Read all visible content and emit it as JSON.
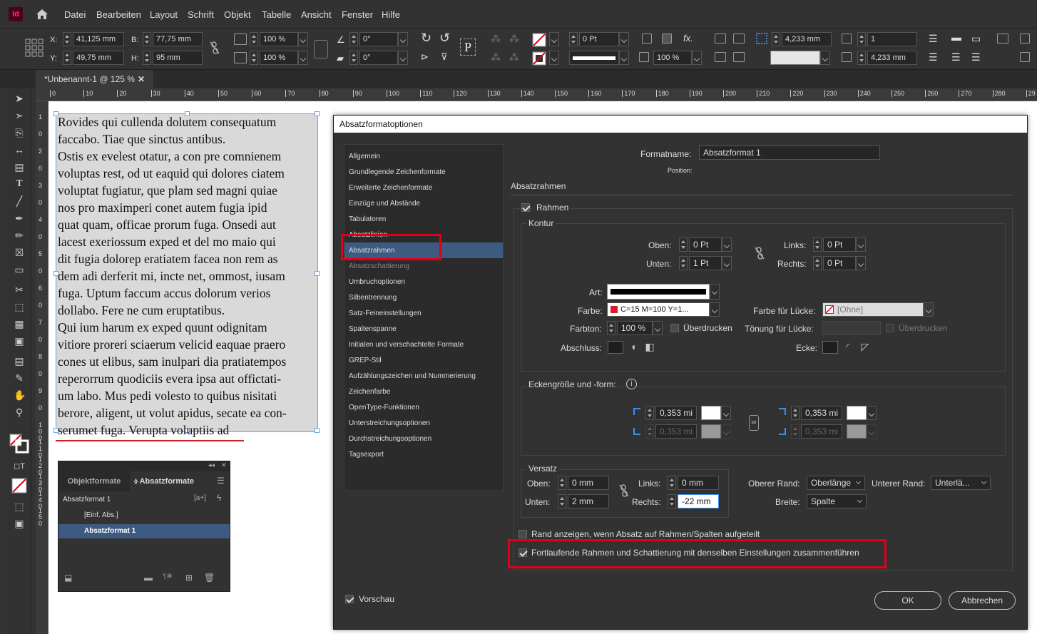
{
  "app": {
    "logo": "Id"
  },
  "menu": [
    "Datei",
    "Bearbeiten",
    "Layout",
    "Schrift",
    "Objekt",
    "Tabelle",
    "Ansicht",
    "Fenster",
    "Hilfe"
  ],
  "control": {
    "x_label": "X:",
    "x": "41,125 mm",
    "y_label": "Y:",
    "y": "49,75 mm",
    "b_label": "B:",
    "b": "77,75 mm",
    "h_label": "H:",
    "h": "95 mm",
    "scale_x": "100 %",
    "scale_y": "100 %",
    "angle": "0°",
    "shear": "0°",
    "stroke": "0 Pt",
    "opacity": "100 %",
    "gutter": "4,233 mm",
    "columns": "1",
    "col_gutter": "4,233 mm"
  },
  "document": {
    "tab": "*Unbenannt-1 @ 125 %"
  },
  "ruler": {
    "h": [
      "0",
      "10",
      "20",
      "30",
      "40",
      "50",
      "60",
      "70",
      "80",
      "90",
      "100",
      "110",
      "120",
      "130",
      "140",
      "150",
      "160",
      "170",
      "180",
      "190",
      "200",
      "210",
      "220",
      "230",
      "240",
      "250",
      "260",
      "270",
      "280",
      "29"
    ],
    "v": [
      "1",
      "0",
      "2",
      "0",
      "3",
      "0",
      "4",
      "0",
      "5",
      "0",
      "6",
      "0",
      "7",
      "0",
      "8",
      "0",
      "9",
      "0",
      "1\n0\n0",
      "1\n1\n0",
      "1\n2\n0",
      "1\n3\n0",
      "1\n4\n0",
      "1\n5\n0"
    ]
  },
  "text_lines": [
    "Rovides qui cullenda dolutem consequatum",
    "faccabo. Tiae que sinctus antibus.",
    "Ostis ex evelest otatur, a con pre comnienem",
    "voluptas rest, od ut eaquid qui dolores ciatem",
    "voluptat fugiatur, que plam sed magni quiae",
    "nos pro maximperi conet autem fugia ipid",
    "quat quam, officae prorum fuga. Onsedi aut",
    "lacest exeriossum exped et del mo maio qui",
    "dit fugia dolorep eratiatem facea non rem as",
    "dem adi derferit mi, incte net, ommost, iusam",
    "fuga. Uptum faccum accus dolorum verios",
    "dollabo. Fere ne cum eruptatibus.",
    "Qui ium harum ex exped quunt odignitam",
    "vitiore proreri sciaerum velicid eaquae praero",
    "cones ut elibus, sam inulpari dia pratiatempos",
    "reperorrum quodiciis evera ipsa aut offictati-",
    "um labo. Mus pedi volesto to quibus nisitati",
    "berore, aligent, ut volut apidus, secate ea con-",
    "serumet fuga. Verupta voluptiis ad"
  ],
  "styles_panel": {
    "tab1": "Objektformate",
    "tab2": "Absatzformate",
    "current": "Absatzformat 1",
    "items": [
      "[Einf. Abs.]",
      "Absatzformat 1"
    ]
  },
  "dialog": {
    "title": "Absatzformatoptionen",
    "categories": [
      "Allgemein",
      "Grundlegende Zeichenformate",
      "Erweiterte Zeichenformate",
      "Einzüge und Abstände",
      "Tabulatoren",
      "Absatzlinien",
      "Absatzrahmen",
      "Absatzschattierung",
      "Umbruchoptionen",
      "Silbentrennung",
      "Satz-Feineinstellungen",
      "Spaltenspanne",
      "Initialen und verschachtelte Formate",
      "GREP-Stil",
      "Aufzählungszeichen und Nummerierung",
      "Zeichenfarbe",
      "OpenType-Funktionen",
      "Unterstreichungsoptionen",
      "Durchstreichungsoptionen",
      "Tagsexport"
    ],
    "selected_category": "Absatzrahmen",
    "formatname_label": "Formatname:",
    "formatname": "Absatzformat 1",
    "position_label": "Position:",
    "section_title": "Absatzrahmen",
    "rahmen_label": "Rahmen",
    "kontur_label": "Kontur",
    "oben_label": "Oben:",
    "oben": "0 Pt",
    "unten_label": "Unten:",
    "unten": "1 Pt",
    "links_label": "Links:",
    "links": "0 Pt",
    "rechts_label": "Rechts:",
    "rechts": "0 Pt",
    "art_label": "Art:",
    "farbe_label": "Farbe:",
    "farbe": "C=15 M=100 Y=1...",
    "farbe_color": "#d0202a",
    "farbton_label": "Farbton:",
    "farbton": "100 %",
    "ueberdrucken": "Überdrucken",
    "abschluss_label": "Abschluss:",
    "farbe_luecke_label": "Farbe für Lücke:",
    "farbe_luecke": "[Ohne]",
    "toenung_luecke_label": "Tönung für Lücke:",
    "ueberdrucken2": "Überdrucken",
    "ecke_label": "Ecke:",
    "eckengroesse_label": "Eckengröße und -form:",
    "corner1": "0,353 mi",
    "corner2": "0,353 mi",
    "corner3": "0,353 mi",
    "corner4": "0,353 mi",
    "versatz_label": "Versatz",
    "v_oben_label": "Oben:",
    "v_oben": "0 mm",
    "v_unten_label": "Unten:",
    "v_unten": "2 mm",
    "v_links_label": "Links:",
    "v_links": "0 mm",
    "v_rechts_label": "Rechts:",
    "v_rechts": "-22 mm",
    "oberer_rand_label": "Oberer Rand:",
    "oberer_rand": "Oberlänge",
    "unterer_rand_label": "Unterer Rand:",
    "unterer_rand": "Unterlä...",
    "breite_label": "Breite:",
    "breite": "Spalte",
    "rand_anzeigen": "Rand anzeigen, wenn Absatz auf Rahmen/Spalten aufgeteilt",
    "fortlaufende": "Fortlaufende Rahmen und Schattierung mit denselben Einstellungen zusammenführen",
    "vorschau": "Vorschau",
    "ok": "OK",
    "abbrechen": "Abbrechen"
  },
  "colors": {
    "accent_red": "#e0001a",
    "selection_blue": "#3d5a80"
  }
}
